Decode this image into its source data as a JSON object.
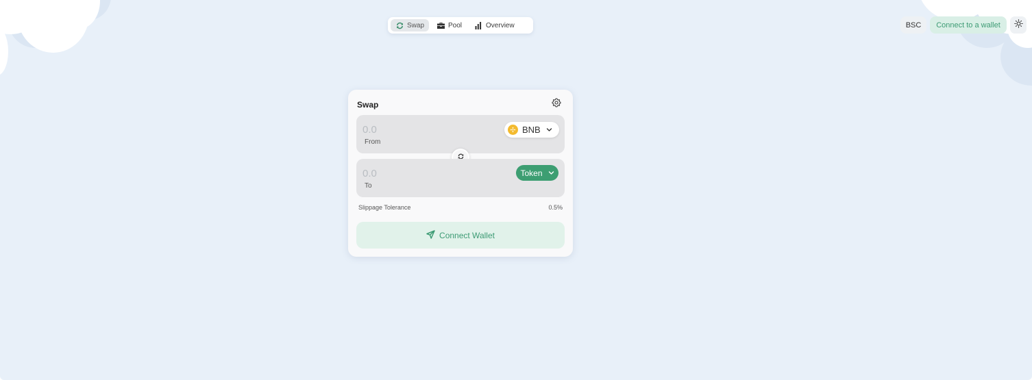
{
  "nav": {
    "items": [
      {
        "label": "Swap",
        "icon": "swap-arrows-icon",
        "active": true
      },
      {
        "label": "Pool",
        "icon": "briefcase-icon",
        "active": false
      },
      {
        "label": "Overview",
        "icon": "bar-chart-icon",
        "active": false
      }
    ]
  },
  "header": {
    "network_label": "BSC",
    "connect_label": "Connect to a wallet",
    "theme_icon": "sun-icon"
  },
  "swap": {
    "title": "Swap",
    "settings_icon": "gear-icon",
    "from": {
      "amount_placeholder": "0.0",
      "label": "From",
      "token": "BNB",
      "token_icon": "bnb-coin-icon"
    },
    "to": {
      "amount_placeholder": "0.0",
      "label": "To",
      "token": "Token"
    },
    "switch_icon": "swap-direction-icon",
    "slippage_label": "Slippage Tolerance",
    "slippage_value": "0.5%",
    "connect_label": "Connect Wallet",
    "connect_icon": "send-arrow-icon"
  },
  "colors": {
    "background": "#e8f0f9",
    "accent": "#3d9e72",
    "accent_light": "#e1f2ea",
    "bnb": "#f3ba2f"
  }
}
